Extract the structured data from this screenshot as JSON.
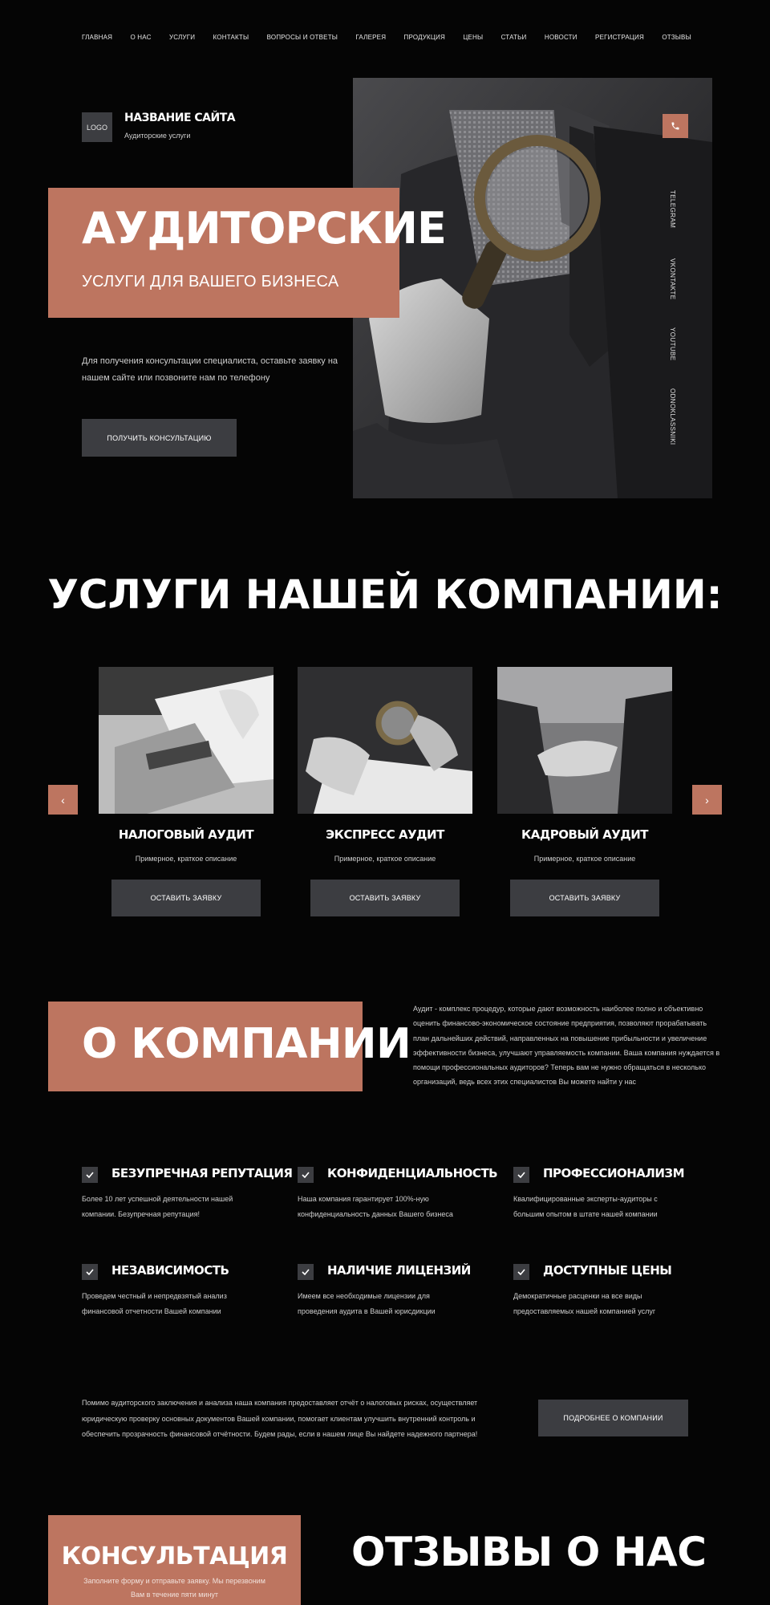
{
  "nav": [
    "ГЛАВНАЯ",
    "О НАС",
    "УСЛУГИ",
    "КОНТАКТЫ",
    "ВОПРОСЫ И ОТВЕТЫ",
    "ГАЛЕРЕЯ",
    "ПРОДУКЦИЯ",
    "ЦЕНЫ",
    "СТАТЬИ",
    "НОВОСТИ",
    "РЕГИСТРАЦИЯ",
    "ОТЗЫВЫ"
  ],
  "header": {
    "logo": "LOGO",
    "site_name": "НАЗВАНИЕ САЙТА",
    "site_sub": "Аудиторские услуги"
  },
  "hero": {
    "title": "АУДИТОРСКИЕ",
    "subtitle": "УСЛУГИ ДЛЯ ВАШЕГО БИЗНЕСА",
    "text": "Для получения консультации специалиста, оставьте заявку на нашем сайте или позвоните нам по телефону",
    "button": "ПОЛУЧИТЬ КОНСУЛЬТАЦИЮ"
  },
  "social": [
    "TELEGRAM",
    "VKONTAKTE",
    "YOUTUBE",
    "ODNOKLASSNIKI"
  ],
  "services": {
    "title": "УСЛУГИ НАШЕЙ КОМПАНИИ:",
    "prev": "‹",
    "next": "›",
    "cards": [
      {
        "title": "НАЛОГОВЫЙ АУДИТ",
        "desc": "Примерное, краткое описание",
        "button": "ОСТАВИТЬ ЗАЯВКУ"
      },
      {
        "title": "ЭКСПРЕСС АУДИТ",
        "desc": "Примерное, краткое описание",
        "button": "ОСТАВИТЬ ЗАЯВКУ"
      },
      {
        "title": "КАДРОВЫЙ АУДИТ",
        "desc": "Примерное, краткое описание",
        "button": "ОСТАВИТЬ ЗАЯВКУ"
      }
    ]
  },
  "about": {
    "title": "О КОМПАНИИ",
    "text": "Аудит - комплекс процедур, которые дают возможность наиболее полно и объективно оценить финансово-экономическое состояние предприятия, позволяют прорабатывать план дальнейших действий, направленных на повышение прибыльности и увеличение эффективности бизнеса, улучшают управляемость компании. Ваша компания нуждается в помощи профессиональных аудиторов? Теперь вам не нужно обращаться в несколько организаций, ведь всех этих специалистов Вы можете найти у нас",
    "features": [
      {
        "title": "БЕЗУПРЕЧНАЯ РЕПУТАЦИЯ",
        "desc": "Более 10 лет успешной деятельности нашей компании. Безупречная репутация!"
      },
      {
        "title": "КОНФИДЕНЦИАЛЬНОСТЬ",
        "desc": "Наша компания гарантирует 100%-ную конфиденциальность данных Вашего бизнеса"
      },
      {
        "title": "ПРОФЕССИОНАЛИЗМ",
        "desc": "Квалифицированные эксперты-аудиторы с большим опытом в штате нашей компании"
      },
      {
        "title": "НЕЗАВИСИМОСТЬ",
        "desc": "Проведем честный и непредвзятый анализ финансовой отчетности Вашей компании"
      },
      {
        "title": "НАЛИЧИЕ ЛИЦЕНЗИЙ",
        "desc": "Имеем все необходимые лицензии для проведения аудита в Вашей юрисдикции"
      },
      {
        "title": "ДОСТУПНЫЕ ЦЕНЫ",
        "desc": "Демократичные расценки на все виды предоставляемых нашей компанией услуг"
      }
    ],
    "more_text": "Помимо аудиторского заключения и анализа наша компания предоставляет отчёт о налоговых рисках, осуществляет юридическую проверку основных документов Вашей компании, помогает клиентам улучшить внутренний контроль и обеспечить прозрачность финансовой отчётности. Будем рады, если в нашем лице Вы найдете надежного партнера!",
    "more_button": "ПОДРОБНЕЕ О КОМПАНИИ"
  },
  "consult": {
    "title": "КОНСУЛЬТАЦИЯ",
    "sub": "Заполните форму и отправьте заявку. Мы перезвоним Вам в течение пяти минут"
  },
  "reviews": {
    "title": "ОТЗЫВЫ О НАС"
  },
  "colors": {
    "accent": "#bd7560",
    "button": "#3c3d41",
    "background": "#050505"
  },
  "icons": {
    "phone": "phone-icon",
    "check": "check-icon",
    "prev": "chevron-left-icon",
    "next": "chevron-right-icon"
  }
}
